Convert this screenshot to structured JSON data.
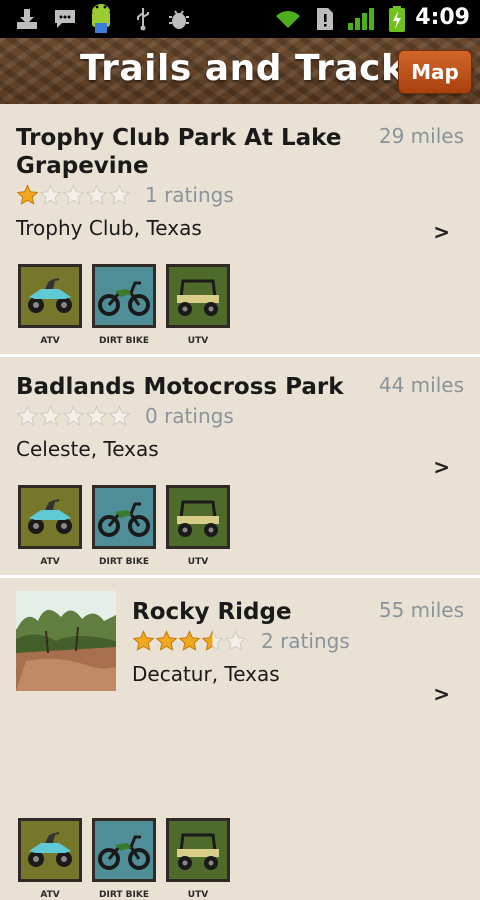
{
  "statusbar": {
    "time": "4:09",
    "icons": [
      "download-icon",
      "sms-icon",
      "android-icon",
      "usb-icon",
      "debug-icon",
      "wifi-icon",
      "alert-icon",
      "signal-icon",
      "battery-icon"
    ]
  },
  "header": {
    "title": "Trails and Tracks",
    "map_label": "Map"
  },
  "vehicle_types": [
    {
      "label": "ATV",
      "icon": "atv-icon",
      "bg": "#77772b"
    },
    {
      "label": "DIRT BIKE",
      "icon": "dirt-bike-icon",
      "bg": "#4f8e97"
    },
    {
      "label": "UTV",
      "icon": "utv-icon",
      "bg": "#4f6b2b"
    }
  ],
  "trails": [
    {
      "name": "Trophy Club Park At Lake Grapevine",
      "distance": "29 miles",
      "stars": 1,
      "ratings": "1 ratings",
      "location": "Trophy Club, Texas",
      "has_thumbnail": false
    },
    {
      "name": "Badlands Motocross Park",
      "distance": "44 miles",
      "stars": 0,
      "ratings": "0 ratings",
      "location": "Celeste, Texas",
      "has_thumbnail": false
    },
    {
      "name": "Rocky Ridge",
      "distance": "55 miles",
      "stars": 3.5,
      "ratings": "2 ratings",
      "location": "Decatur, Texas",
      "has_thumbnail": true
    }
  ],
  "chevron": ">"
}
